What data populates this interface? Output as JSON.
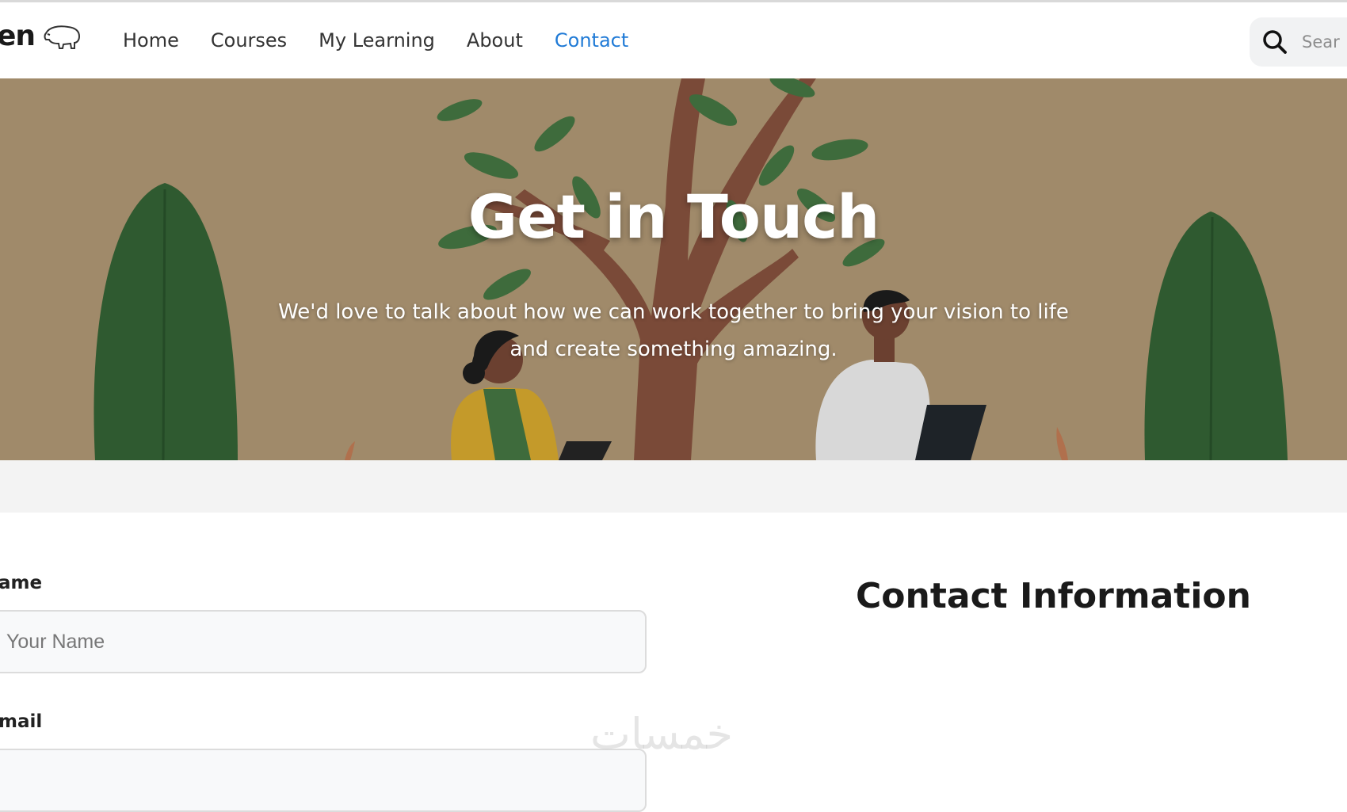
{
  "brand": {
    "text": "en"
  },
  "nav": {
    "items": [
      {
        "label": "Home"
      },
      {
        "label": "Courses"
      },
      {
        "label": "My Learning"
      },
      {
        "label": "About"
      },
      {
        "label": "Contact",
        "active": true
      }
    ]
  },
  "search": {
    "placeholder": "Sear"
  },
  "hero": {
    "title": "Get in Touch",
    "subtitle": "We'd love to talk about how we can work together to bring your vision to life and create something amazing."
  },
  "form": {
    "name_label": "ame",
    "name_placeholder": "Your Name",
    "email_label": "mail"
  },
  "contact_info": {
    "title": "Contact Information"
  },
  "watermark": {
    "text": "خمسات"
  },
  "colors": {
    "accent": "#1f7ad6",
    "hero_bg": "#a08a6a"
  }
}
